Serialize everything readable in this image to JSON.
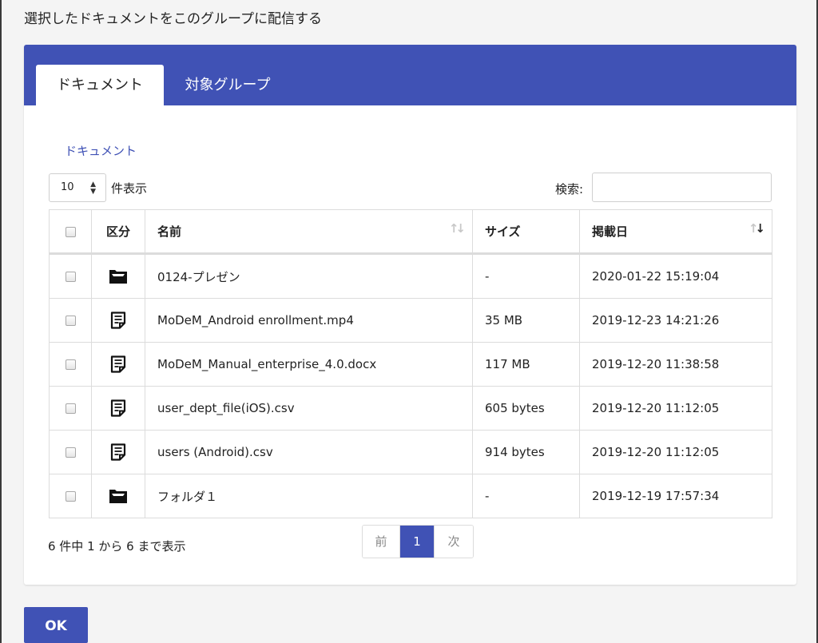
{
  "dialog": {
    "title": "選択したドキュメントをこのグループに配信する"
  },
  "tabs": [
    {
      "label": "ドキュメント",
      "active": true
    },
    {
      "label": "対象グループ",
      "active": false
    }
  ],
  "section_title": "ドキュメント",
  "length_menu": {
    "selected": "10",
    "label": "件表示"
  },
  "search": {
    "label": "検索:",
    "value": ""
  },
  "table": {
    "headers": {
      "select": "",
      "type": "区分",
      "name": "名前",
      "size": "サイズ",
      "date": "掲載日"
    },
    "sort": {
      "column": "date",
      "direction": "desc"
    },
    "rows": [
      {
        "icon": "folder-icon",
        "name": "0124-プレゼン",
        "size": "-",
        "date": "2020-01-22 15:19:04"
      },
      {
        "icon": "document-icon",
        "name": "MoDeM_Android enrollment.mp4",
        "size": "35 MB",
        "date": "2019-12-23 14:21:26"
      },
      {
        "icon": "document-icon",
        "name": "MoDeM_Manual_enterprise_4.0.docx",
        "size": "117 MB",
        "date": "2019-12-20 11:38:58"
      },
      {
        "icon": "document-icon",
        "name": "user_dept_file(iOS).csv",
        "size": "605 bytes",
        "date": "2019-12-20 11:12:05"
      },
      {
        "icon": "document-icon",
        "name": "users (Android).csv",
        "size": "914 bytes",
        "date": "2019-12-20 11:12:05"
      },
      {
        "icon": "folder-icon",
        "name": "フォルダ１",
        "size": "-",
        "date": "2019-12-19 17:57:34"
      }
    ]
  },
  "info_text": "6 件中 1 から 6 まで表示",
  "pagination": {
    "prev": "前",
    "current": "1",
    "next": "次"
  },
  "ok_button": "OK",
  "colors": {
    "accent": "#4052b5",
    "link": "#3f51b5"
  }
}
